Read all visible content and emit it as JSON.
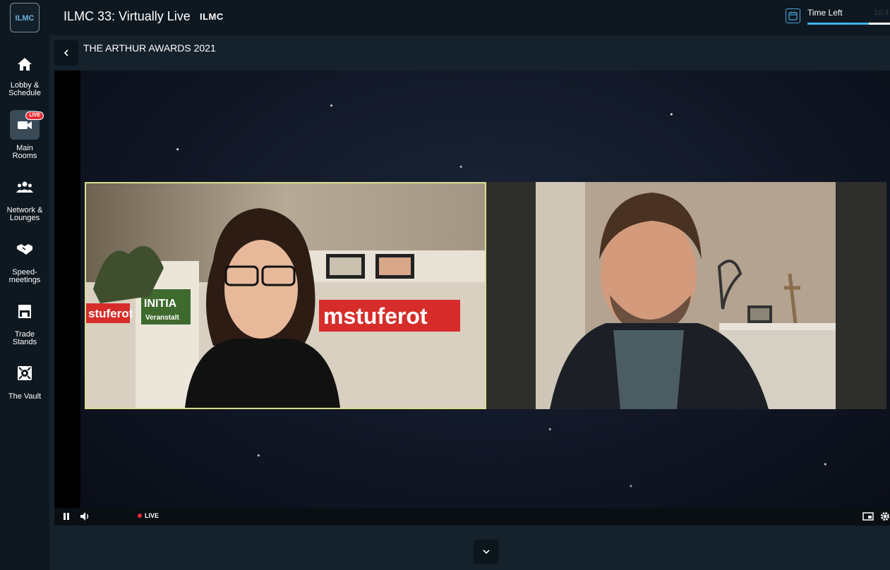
{
  "header": {
    "logo_text": "ILMC",
    "event_title": "ILMC 33: Virtually Live",
    "brand": "ILMC",
    "time_left_label": "Time Left",
    "time_left_value": "1d:4",
    "time_progress": 0.74,
    "accent_color": "#3fb6e8"
  },
  "sidebar": {
    "items": [
      {
        "label": "Lobby & Schedule",
        "icon": "home-icon",
        "active": false
      },
      {
        "label": "Main Rooms",
        "icon": "video-camera-icon",
        "active": true,
        "badge": "LIVE"
      },
      {
        "label": "Network & Lounges",
        "icon": "people-icon",
        "active": false
      },
      {
        "label": "Speed-meetings",
        "icon": "handshake-icon",
        "active": false
      },
      {
        "label": "Trade Stands",
        "icon": "storefront-icon",
        "active": false
      },
      {
        "label": "The Vault",
        "icon": "vault-icon",
        "active": false
      }
    ]
  },
  "session": {
    "title": "THE ARTHUR AWARDS 2021"
  },
  "player": {
    "live_label": "LIVE",
    "live_color": "#e6303a",
    "tiles": [
      {
        "highlight_color": "#d8df8e",
        "sign_text_1": "stuferot",
        "sign_text_2": "INITIA",
        "sign_text_3": "Veranstalt",
        "sign_text_4": "mstuferot"
      },
      {
        "highlight_color": "none"
      }
    ]
  }
}
